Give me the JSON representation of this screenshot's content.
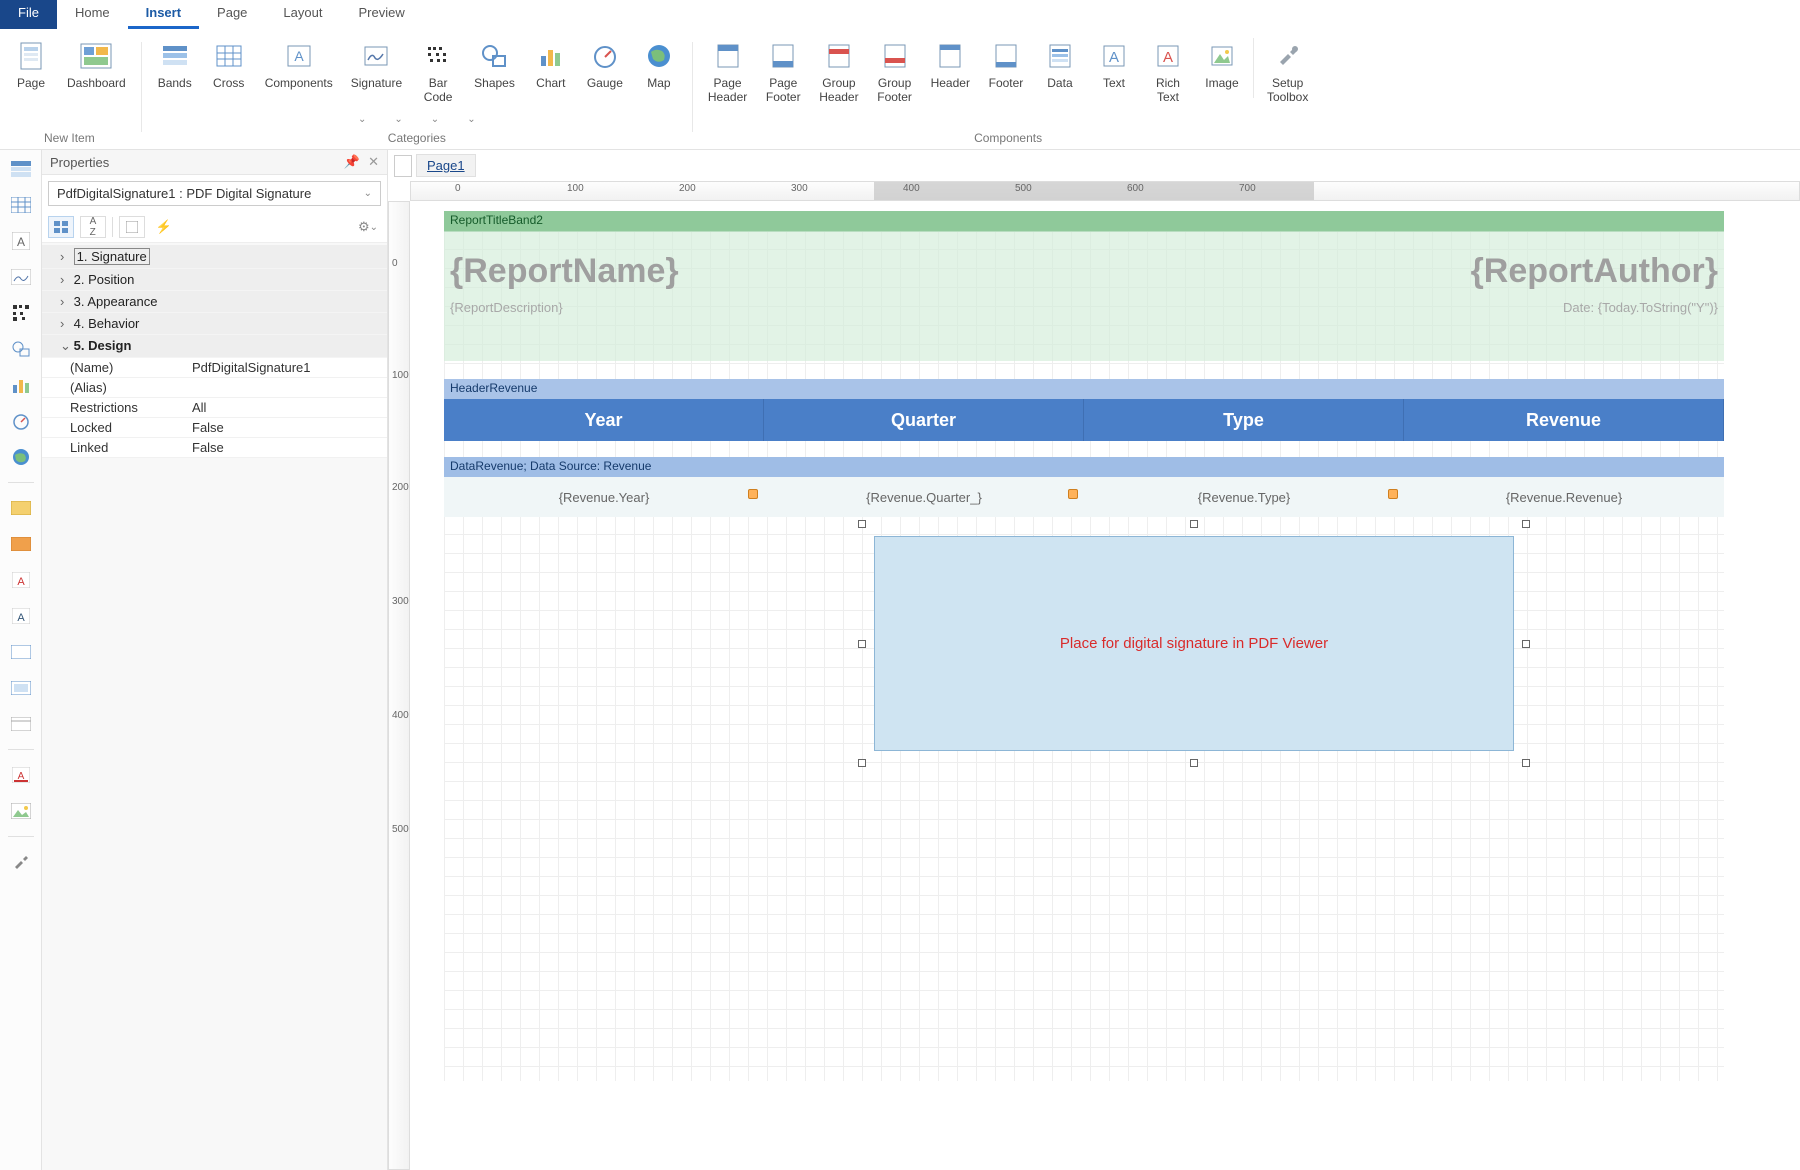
{
  "tabs": {
    "file": "File",
    "home": "Home",
    "insert": "Insert",
    "page": "Page",
    "layout": "Layout",
    "preview": "Preview",
    "active": "insert"
  },
  "ribbon": {
    "newitem": {
      "label": "New Item",
      "page": "Page",
      "dashboard": "Dashboard"
    },
    "categories": {
      "label": "Categories",
      "bands": "Bands",
      "cross": "Cross",
      "components": "Components",
      "signature": "Signature",
      "barcode": "Bar\nCode",
      "shapes": "Shapes",
      "chart": "Chart",
      "gauge": "Gauge",
      "map": "Map"
    },
    "components": {
      "label": "Components",
      "pageheader": "Page\nHeader",
      "pagefooter": "Page\nFooter",
      "groupheader": "Group\nHeader",
      "groupfooter": "Group\nFooter",
      "header": "Header",
      "footer": "Footer",
      "data": "Data",
      "text": "Text",
      "richtext": "Rich\nText",
      "image": "Image",
      "setup": "Setup\nToolbox"
    }
  },
  "props": {
    "title": "Properties",
    "selector": "PdfDigitalSignature1 : PDF Digital Signature",
    "cats": [
      "1. Signature",
      "2. Position",
      "3. Appearance",
      "4. Behavior",
      "5. Design"
    ],
    "design": {
      "name_k": "(Name)",
      "name_v": "PdfDigitalSignature1",
      "alias_k": "(Alias)",
      "alias_v": "",
      "restr_k": "Restrictions",
      "restr_v": "All",
      "locked_k": "Locked",
      "locked_v": "False",
      "linked_k": "Linked",
      "linked_v": "False"
    }
  },
  "pagetab": "Page1",
  "rulerh": [
    "0",
    "100",
    "200",
    "300",
    "400",
    "500",
    "600",
    "700"
  ],
  "rulerv": [
    "0",
    "100",
    "200",
    "300",
    "400",
    "500"
  ],
  "report": {
    "titleband": "ReportTitleBand2",
    "name": "{ReportName}",
    "author": "{ReportAuthor}",
    "desc": "{ReportDescription}",
    "date": "Date: {Today.ToString(\"Y\")}",
    "headerband": "HeaderRevenue",
    "cols": [
      "Year",
      "Quarter",
      "Type",
      "Revenue"
    ],
    "databand": "DataRevenue; Data Source: Revenue",
    "fields": [
      "{Revenue.Year}",
      "{Revenue.Quarter_}",
      "{Revenue.Type}",
      "{Revenue.Revenue}"
    ],
    "sig": "Place for digital signature in PDF Viewer"
  }
}
